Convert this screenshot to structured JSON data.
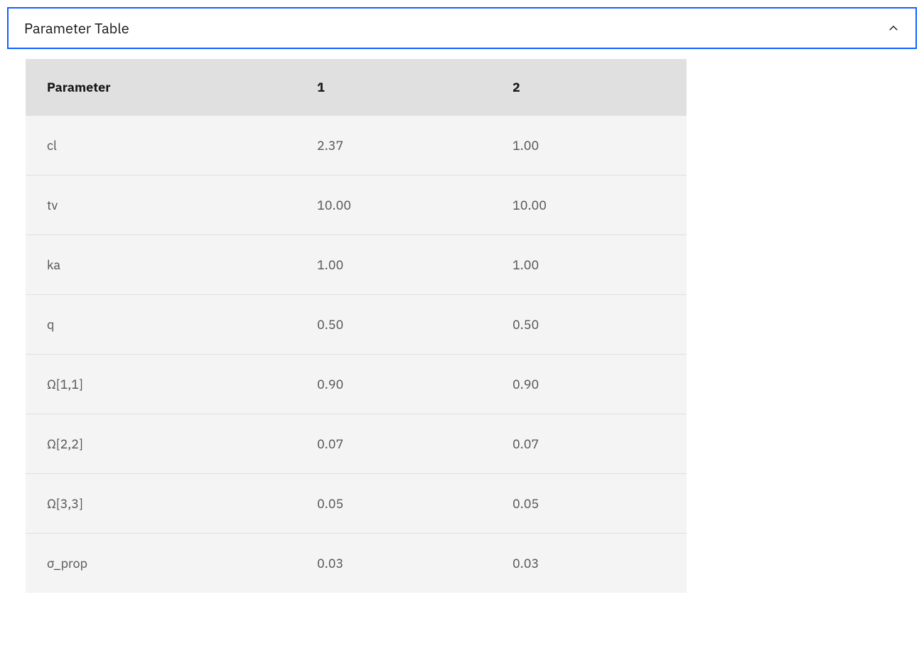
{
  "accordion": {
    "title": "Parameter Table",
    "expanded": true
  },
  "table": {
    "headers": [
      "Parameter",
      "1",
      "2"
    ],
    "rows": [
      {
        "param": "cl",
        "v1": "2.37",
        "v2": "1.00"
      },
      {
        "param": "tv",
        "v1": "10.00",
        "v2": "10.00"
      },
      {
        "param": "ka",
        "v1": "1.00",
        "v2": "1.00"
      },
      {
        "param": "q",
        "v1": "0.50",
        "v2": "0.50"
      },
      {
        "param": "Ω[1,1]",
        "v1": "0.90",
        "v2": "0.90"
      },
      {
        "param": "Ω[2,2]",
        "v1": "0.07",
        "v2": "0.07"
      },
      {
        "param": "Ω[3,3]",
        "v1": "0.05",
        "v2": "0.05"
      },
      {
        "param": "σ_prop",
        "v1": "0.03",
        "v2": "0.03"
      }
    ]
  }
}
